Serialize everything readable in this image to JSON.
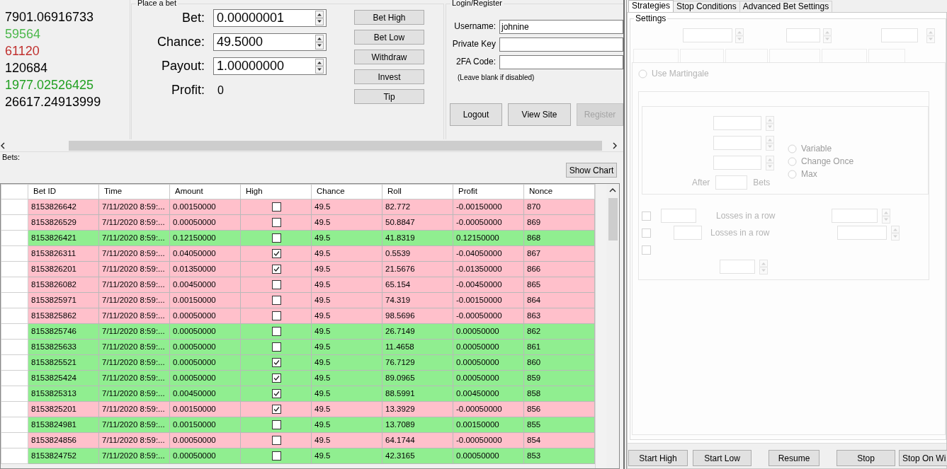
{
  "stats": [
    {
      "value": "7901.06916733",
      "color": "#000000"
    },
    {
      "value": "59564",
      "color": "#4cb84c"
    },
    {
      "value": "61120",
      "color": "#c0302e"
    },
    {
      "value": "120684",
      "color": "#000000"
    },
    {
      "value": "1977.02526425",
      "color": "#22a022"
    },
    {
      "value": "26617.24913999",
      "color": "#000000"
    }
  ],
  "place_bet": {
    "title": "Place a bet",
    "fields": [
      {
        "label": "Bet:",
        "value": "0.00000001"
      },
      {
        "label": "Chance:",
        "value": "49.5000"
      },
      {
        "label": "Payout:",
        "value": "1.00000000"
      }
    ],
    "profit": {
      "label": "Profit:",
      "value": "0"
    },
    "buttons": [
      "Bet High",
      "Bet Low",
      "Withdraw",
      "Invest",
      "Tip"
    ]
  },
  "login": {
    "title": "Login/Register",
    "fields": [
      {
        "label": "Username:",
        "value": "johnine"
      },
      {
        "label": "Private Key"
      },
      {
        "label": "2FA Code:"
      }
    ],
    "hint": "(Leave blank if disabled)",
    "buttons": [
      {
        "label": "Logout",
        "disabled": false
      },
      {
        "label": "View Site",
        "disabled": false
      },
      {
        "label": "Register",
        "disabled": true
      }
    ]
  },
  "bets": {
    "label": "Bets:",
    "show_chart": "Show Chart",
    "columns": [
      "Bet ID",
      "Time",
      "Amount",
      "High",
      "Chance",
      "Roll",
      "Profit",
      "Nonce"
    ],
    "rows": [
      {
        "bet_id": "8153826642",
        "time": "7/11/2020 8:59:...",
        "amount": "0.00150000",
        "high": false,
        "chance": "49.5",
        "roll": "82.772",
        "profit": "-0.00150000",
        "nonce": "870",
        "color": "#ffc0cb"
      },
      {
        "bet_id": "8153826529",
        "time": "7/11/2020 8:59:...",
        "amount": "0.00050000",
        "high": false,
        "chance": "49.5",
        "roll": "50.8847",
        "profit": "-0.00050000",
        "nonce": "869",
        "color": "#ffc0cb"
      },
      {
        "bet_id": "8153826421",
        "time": "7/11/2020 8:59:...",
        "amount": "0.12150000",
        "high": false,
        "chance": "49.5",
        "roll": "41.8319",
        "profit": "0.12150000",
        "nonce": "868",
        "color": "#90ee90"
      },
      {
        "bet_id": "8153826311",
        "time": "7/11/2020 8:59:...",
        "amount": "0.04050000",
        "high": true,
        "chance": "49.5",
        "roll": "0.5539",
        "profit": "-0.04050000",
        "nonce": "867",
        "color": "#ffc0cb"
      },
      {
        "bet_id": "8153826201",
        "time": "7/11/2020 8:59:...",
        "amount": "0.01350000",
        "high": true,
        "chance": "49.5",
        "roll": "21.5676",
        "profit": "-0.01350000",
        "nonce": "866",
        "color": "#ffc0cb"
      },
      {
        "bet_id": "8153826082",
        "time": "7/11/2020 8:59:...",
        "amount": "0.00450000",
        "high": false,
        "chance": "49.5",
        "roll": "65.154",
        "profit": "-0.00450000",
        "nonce": "865",
        "color": "#ffc0cb"
      },
      {
        "bet_id": "8153825971",
        "time": "7/11/2020 8:59:...",
        "amount": "0.00150000",
        "high": false,
        "chance": "49.5",
        "roll": "74.319",
        "profit": "-0.00150000",
        "nonce": "864",
        "color": "#ffc0cb"
      },
      {
        "bet_id": "8153825862",
        "time": "7/11/2020 8:59:...",
        "amount": "0.00050000",
        "high": false,
        "chance": "49.5",
        "roll": "98.5696",
        "profit": "-0.00050000",
        "nonce": "863",
        "color": "#ffc0cb"
      },
      {
        "bet_id": "8153825746",
        "time": "7/11/2020 8:59:...",
        "amount": "0.00050000",
        "high": false,
        "chance": "49.5",
        "roll": "26.7149",
        "profit": "0.00050000",
        "nonce": "862",
        "color": "#90ee90"
      },
      {
        "bet_id": "8153825633",
        "time": "7/11/2020 8:59:...",
        "amount": "0.00050000",
        "high": false,
        "chance": "49.5",
        "roll": "11.4658",
        "profit": "0.00050000",
        "nonce": "861",
        "color": "#90ee90"
      },
      {
        "bet_id": "8153825521",
        "time": "7/11/2020 8:59:...",
        "amount": "0.00050000",
        "high": true,
        "chance": "49.5",
        "roll": "76.7129",
        "profit": "0.00050000",
        "nonce": "860",
        "color": "#90ee90"
      },
      {
        "bet_id": "8153825424",
        "time": "7/11/2020 8:59:...",
        "amount": "0.00050000",
        "high": true,
        "chance": "49.5",
        "roll": "89.0965",
        "profit": "0.00050000",
        "nonce": "859",
        "color": "#90ee90"
      },
      {
        "bet_id": "8153825313",
        "time": "7/11/2020 8:59:...",
        "amount": "0.00450000",
        "high": true,
        "chance": "49.5",
        "roll": "88.5991",
        "profit": "0.00450000",
        "nonce": "858",
        "color": "#90ee90"
      },
      {
        "bet_id": "8153825201",
        "time": "7/11/2020 8:59:...",
        "amount": "0.00150000",
        "high": true,
        "chance": "49.5",
        "roll": "13.3929",
        "profit": "-0.00050000",
        "nonce": "856",
        "color": "#ffc0cb"
      },
      {
        "bet_id": "8153824981",
        "time": "7/11/2020 8:59:...",
        "amount": "0.00150000",
        "high": false,
        "chance": "49.5",
        "roll": "13.7089",
        "profit": "0.00150000",
        "nonce": "855",
        "color": "#90ee90"
      },
      {
        "bet_id": "8153824856",
        "time": "7/11/2020 8:59:...",
        "amount": "0.00050000",
        "high": false,
        "chance": "49.5",
        "roll": "64.1744",
        "profit": "-0.00050000",
        "nonce": "854",
        "color": "#ffc0cb"
      },
      {
        "bet_id": "8153824752",
        "time": "7/11/2020 8:59:...",
        "amount": "0.00050000",
        "high": false,
        "chance": "49.5",
        "roll": "42.3165",
        "profit": "0.00050000",
        "nonce": "853",
        "color": "#90ee90"
      }
    ]
  },
  "right_panel": {
    "tabs": [
      {
        "label": "Strategies",
        "selected": true
      },
      {
        "label": "Stop Conditions",
        "selected": false
      },
      {
        "label": "Advanced Bet Settings",
        "selected": false
      }
    ],
    "settings": {
      "title": "Settings",
      "use_martingale": "Use Martingale",
      "modes": [
        "Variable",
        "Change Once",
        "Max"
      ],
      "after": "After",
      "bets": "Bets",
      "rules": [
        "Losses in a row",
        "Losses in a row"
      ]
    },
    "buttons": [
      "Start High",
      "Start Low",
      "Resume",
      "Stop",
      "Stop On Wi"
    ]
  }
}
